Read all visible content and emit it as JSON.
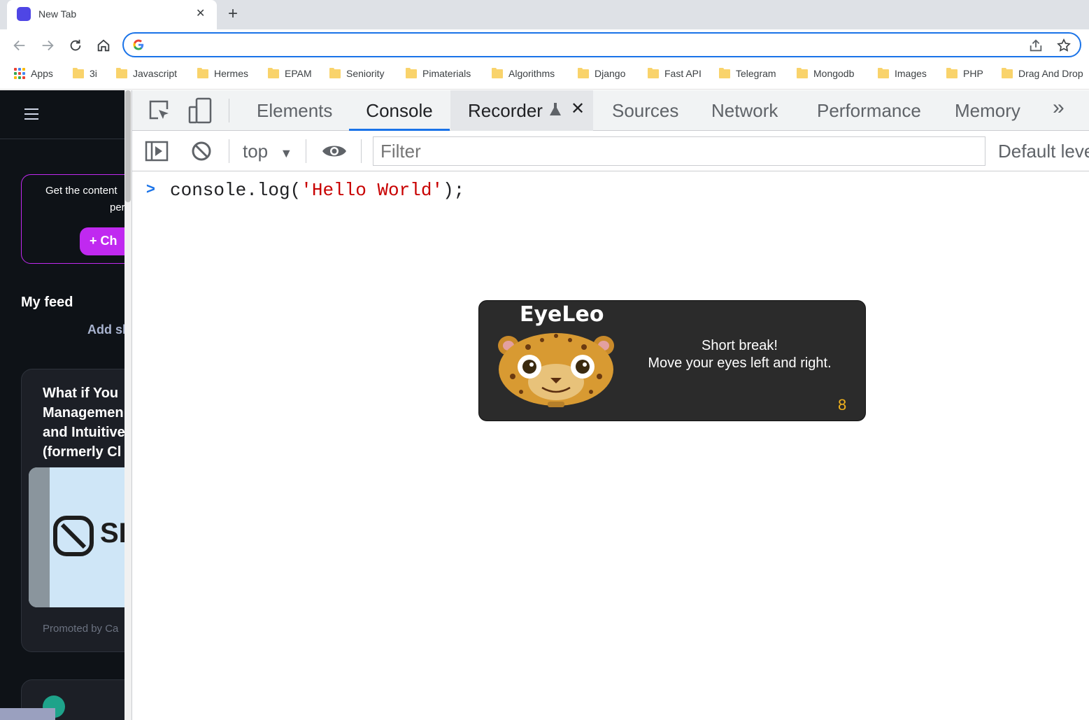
{
  "browser": {
    "tab_title": "New Tab",
    "new_tab_symbol": "+",
    "close_symbol": "✕",
    "omnibox_value": ""
  },
  "bookmarks": {
    "apps_label": "Apps",
    "folders": [
      "3i",
      "Javascript",
      "Hermes",
      "EPAM",
      "Seniority",
      "Pimaterials",
      "Algorithms",
      "Django",
      "Fast API",
      "Telegram",
      "Mongodb",
      "Images",
      "PHP",
      "Drag And Drop"
    ]
  },
  "left_page": {
    "promo_line1": "Get the content",
    "promo_line2": "per",
    "promo_button": "+ Ch",
    "feed_title": "My feed",
    "add_shortcut": "Add sh",
    "card_title": "What if You\nManagemen\nand Intuitive\n(formerly Cl",
    "card_logo_text": "SI",
    "card_footer": "Promoted by Ca"
  },
  "devtools": {
    "tabs": [
      "Elements",
      "Console",
      "Recorder",
      "Sources",
      "Network",
      "Performance",
      "Memory"
    ],
    "active_tab": "Console",
    "more_tabs_symbol": "»",
    "context": "top",
    "filter_placeholder": "Filter",
    "levels": "Default leve",
    "console_code_prefix": "console.log(",
    "console_code_string": "'Hello World'",
    "console_code_suffix": ");"
  },
  "eyeleo": {
    "title": "EyeLeo",
    "message_line1": "Short break!",
    "message_line2": "Move your eyes left and right.",
    "countdown": "8"
  },
  "colors": {
    "accent": "#1a73e8",
    "promo_purple": "#c029f0",
    "countdown": "#f0b11d",
    "console_string": "#c80000"
  }
}
